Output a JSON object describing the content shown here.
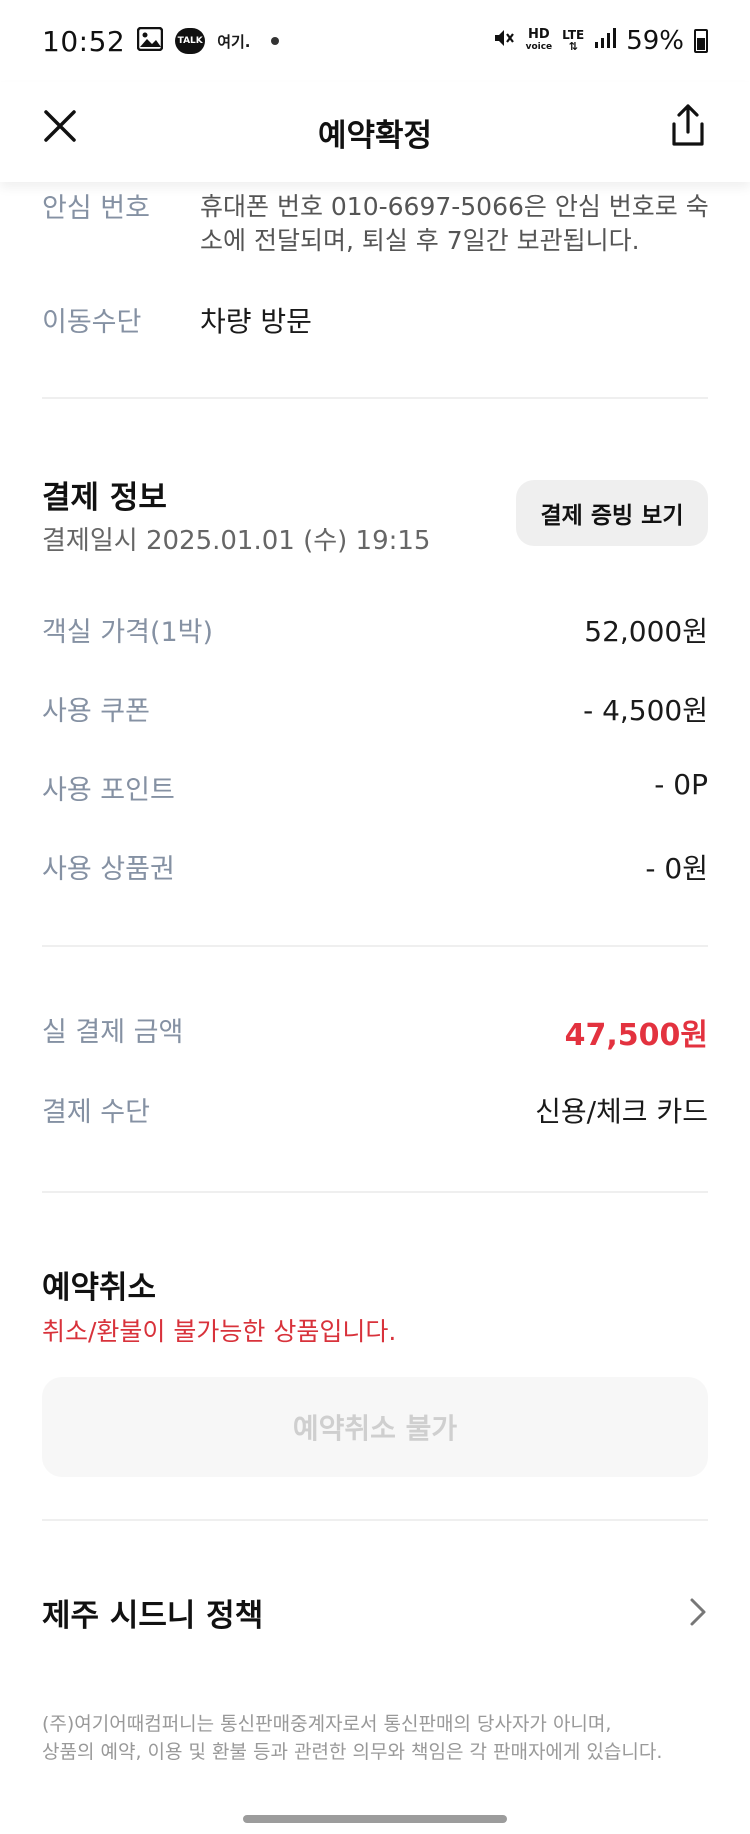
{
  "status_bar": {
    "time": "10:52",
    "notif_talk": "TALK",
    "notif_brand": "여기.",
    "hd_label": "HD",
    "hd_sub": "voice",
    "lte_label": "LTE",
    "battery": "59%"
  },
  "header": {
    "title": "예약확정"
  },
  "info": {
    "safe_number_label": "안심 번호",
    "safe_number_text": "휴대폰 번호 010-6697-5066은 안심 번호로 숙소에 전달되며, 퇴실 후 7일간 보관됩니다.",
    "transport_label": "이동수단",
    "transport_value": "차량 방문"
  },
  "payment": {
    "title": "결제 정보",
    "date": "결제일시 2025.01.01 (수) 19:15",
    "receipt_button": "결제 증빙 보기",
    "rows": [
      {
        "label": "객실 가격(1박)",
        "value": "52,000원"
      },
      {
        "label": "사용 쿠폰",
        "value": "- 4,500원"
      },
      {
        "label": "사용 포인트",
        "value": "- 0P"
      },
      {
        "label": "사용 상품권",
        "value": "- 0원"
      }
    ],
    "total_label": "실 결제 금액",
    "total_value": "47,500원",
    "method_label": "결제 수단",
    "method_value": "신용/체크 카드"
  },
  "cancel": {
    "title": "예약취소",
    "note": "취소/환불이 불가능한 상품입니다.",
    "button": "예약취소 불가"
  },
  "policy": {
    "title": "제주 시드니 정책"
  },
  "footer": {
    "line1": "(주)여기어때컴퍼니는 통신판매중계자로서 통신판매의 당사자가 아니며,",
    "line2": "상품의 예약, 이용 및 환불 등과 관련한 의무와 책임은 각 판매자에게 있습니다."
  },
  "colors": {
    "accent_red": "#e3323f",
    "label_gray": "#8591a3"
  }
}
